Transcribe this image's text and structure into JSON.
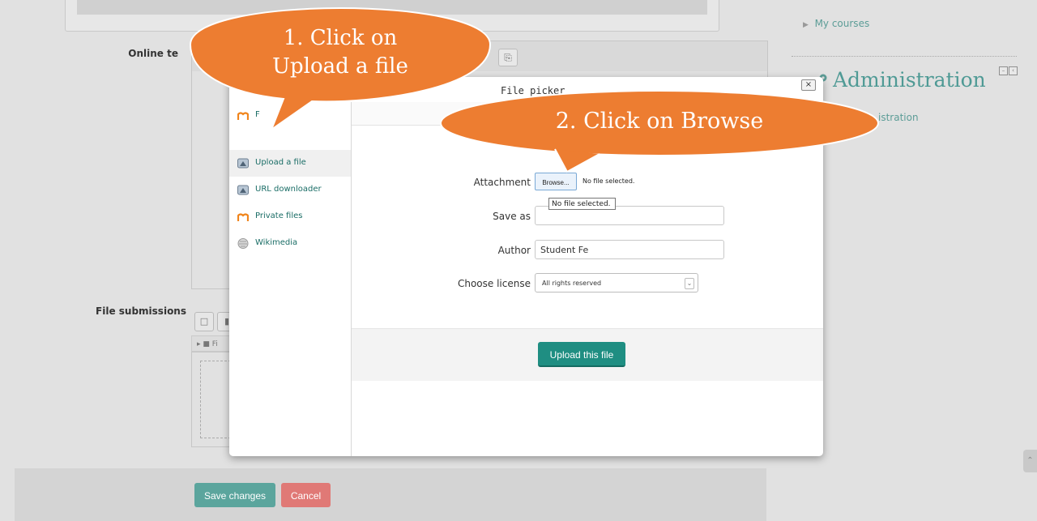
{
  "form": {
    "online_text_label": "Online te",
    "file_submissions_label": "File submissions",
    "file_folder_label": "Fi",
    "save_label": "Save changes",
    "cancel_label": "Cancel"
  },
  "sidebar": {
    "my_courses": "My courses",
    "administration_title": "Administration",
    "administration_sub": "istration"
  },
  "file_picker": {
    "title": "File picker",
    "close_glyph": "×",
    "repositories": [
      {
        "label": "F",
        "icon": "moodle-icon"
      },
      {
        "label": "Upload a file",
        "icon": "upload-icon",
        "active": true
      },
      {
        "label": "URL downloader",
        "icon": "url-icon"
      },
      {
        "label": "Private files",
        "icon": "moodle-icon"
      },
      {
        "label": "Wikimedia",
        "icon": "wikimedia-icon"
      }
    ],
    "attachment_label": "Attachment",
    "browse_label": "Browse...",
    "no_file_text": "No file selected.",
    "tooltip_text": "No file selected.",
    "save_as_label": "Save as",
    "save_as_value": "",
    "author_label": "Author",
    "author_value": "Student Fe",
    "license_label": "Choose license",
    "license_value": "All rights reserved",
    "upload_label": "Upload this file"
  },
  "callouts": {
    "one_line1": "1. Click on",
    "one_line2": "Upload a file",
    "two": "2. Click on Browse",
    "fill_color": "#ed7d31",
    "stroke_color": "#ffffff"
  },
  "colors": {
    "accent": "#1f8e82",
    "link": "#5c9d97",
    "cancel": "#e07976"
  }
}
